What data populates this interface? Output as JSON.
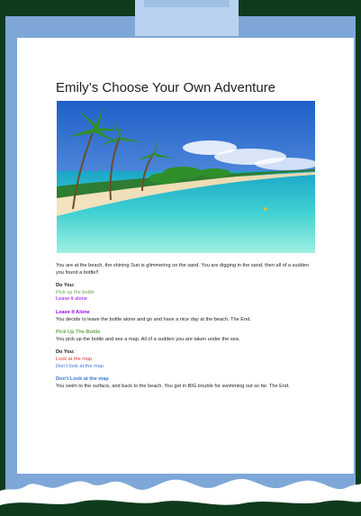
{
  "document": {
    "title": "Emily’s Choose Your Own Adventure",
    "image_alt": "tropical beach with palm trees and turquoise water",
    "intro": "You are at the beach, the shining Sun is glimmering on the sand. You are digging in the sand, then all of a sudden you found a bottle!!",
    "choice1": {
      "heading": "Do You:",
      "option_a": "Pick up the bottle",
      "option_b": "Leave it alone"
    },
    "leave_alone": {
      "heading": "Leave It Alone",
      "text": "You decide to leave the bottle alone and go and have a nice day at the beach. The End."
    },
    "pick_up": {
      "heading": "Pick Up The Bottle",
      "text": "You pick up the bottle and see a map. All of a sudden you are taken under the sea."
    },
    "choice2": {
      "heading": "Do You:",
      "option_a": "Look at the map",
      "option_b": "Don’t look at the map"
    },
    "dont_look": {
      "heading": "Don’t Look at the map",
      "text": "You swim to the surface, and back to the beach. You get in BIG trouble for swimming out so far. The End."
    }
  },
  "colors": {
    "background": "#0f3b1d",
    "frame": "#7ea7d8",
    "green": "#6aa84f",
    "purple": "#9900ff",
    "red": "#e53935",
    "blue": "#3c78d8"
  }
}
